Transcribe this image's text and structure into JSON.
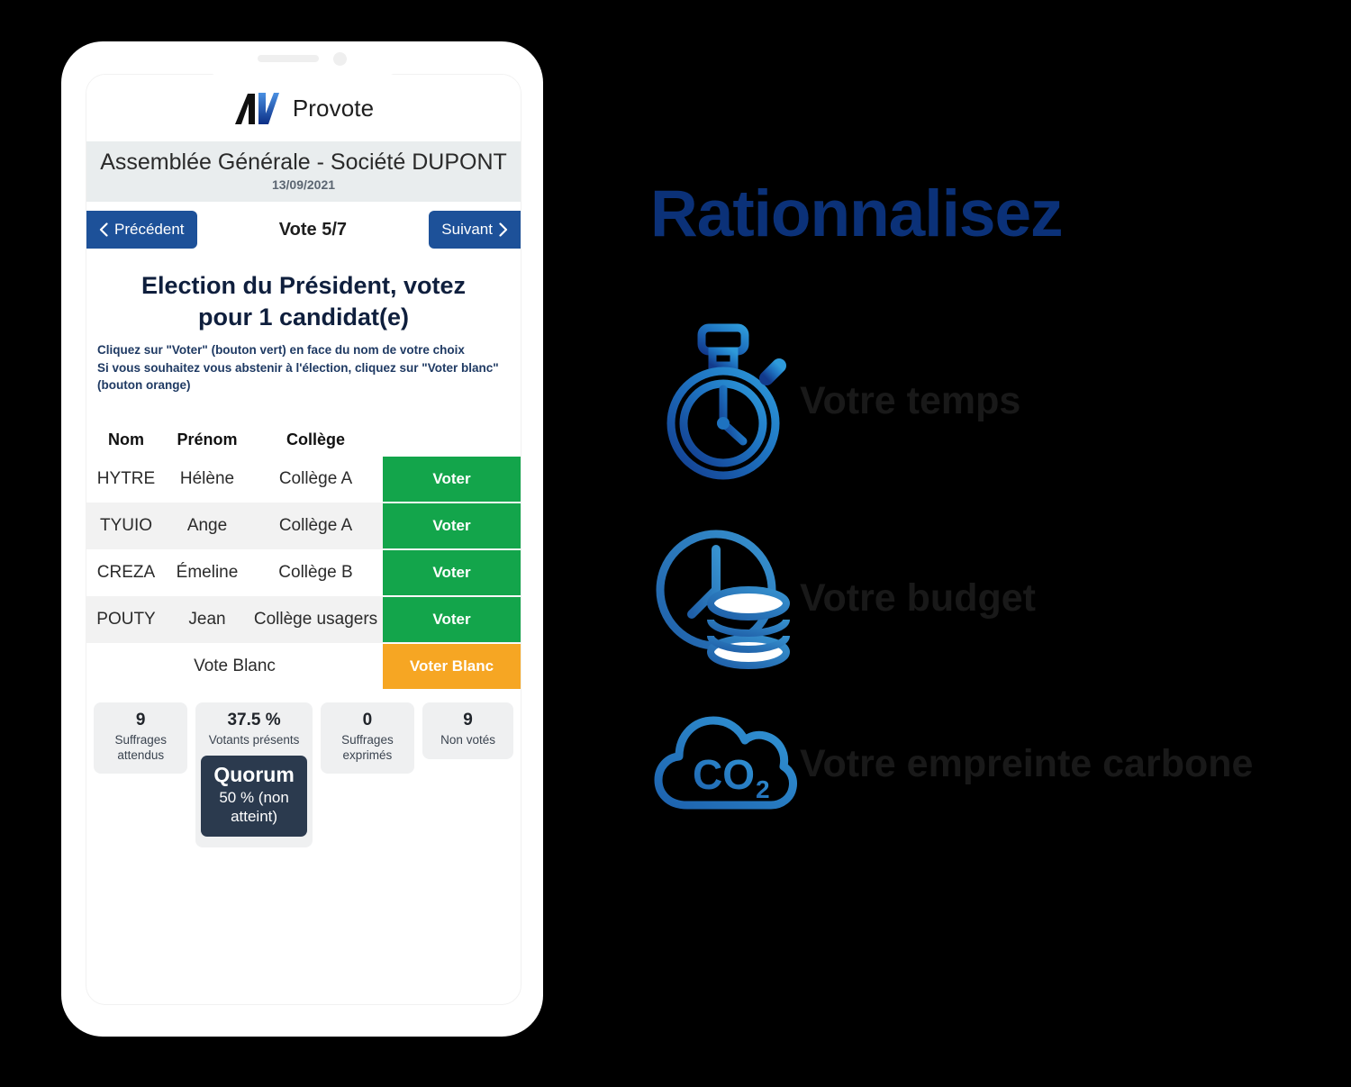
{
  "phone": {
    "app": {
      "brand": "Provote",
      "logo_icon": "provote-logo-icon"
    },
    "meeting": {
      "assembly": "Assemblée Générale - ",
      "company": "Société DUPONT",
      "date": "13/09/2021"
    },
    "nav": {
      "prev_label": "Précédent",
      "prev_icon": "chevron-left-icon",
      "next_label": "Suivant",
      "next_icon": "chevron-right-icon",
      "counter": "Vote 5/7"
    },
    "question": {
      "title": "Election du Président, votez pour 1 candidat(e)",
      "hint_line_1": "Cliquez sur \"Voter\" (bouton vert) en face du nom de votre choix",
      "hint_line_2": "Si vous souhaitez vous abstenir à l'élection, cliquez sur \"Voter blanc\"",
      "hint_line_3": "(bouton orange)"
    },
    "table": {
      "headers": [
        "Nom",
        "Prénom",
        "Collège"
      ],
      "rows": [
        {
          "nom": "HYTRE",
          "prenom": "Hélène",
          "college": "Collège A",
          "action": "Voter"
        },
        {
          "nom": "TYUIO",
          "prenom": "Ange",
          "college": "Collège A",
          "action": "Voter"
        },
        {
          "nom": "CREZA",
          "prenom": "Émeline",
          "college": "Collège B",
          "action": "Voter"
        },
        {
          "nom": "POUTY",
          "prenom": "Jean",
          "college": "Collège usagers",
          "action": "Voter"
        }
      ],
      "blank_row": {
        "label": "Vote Blanc",
        "action": "Voter Blanc"
      }
    },
    "stats": [
      {
        "value": "9",
        "label": "Suffrages attendus"
      },
      {
        "value": "37.5 %",
        "label": "Votants présents"
      },
      {
        "value": "0",
        "label": "Suffrages exprimés"
      },
      {
        "value": "9",
        "label": "Non votés"
      }
    ],
    "quorum": {
      "title": "Quorum",
      "detail": "50 % (non atteint)"
    }
  },
  "panel": {
    "headline": "Rationnalisez",
    "features": [
      {
        "label": "Votre temps",
        "icon": "stopwatch-icon"
      },
      {
        "label": "Votre budget",
        "icon": "clock-coins-icon"
      },
      {
        "label": "Votre empreinte carbone",
        "icon": "co2-cloud-icon"
      }
    ]
  },
  "colors": {
    "brand_blue": "#1d5199",
    "headline_blue": "#0b3178",
    "vote_green": "#13a54b",
    "vote_orange": "#f6a623",
    "quorum_navy": "#2b3a4e",
    "header_gray": "#e9edee",
    "background": "#000000"
  }
}
